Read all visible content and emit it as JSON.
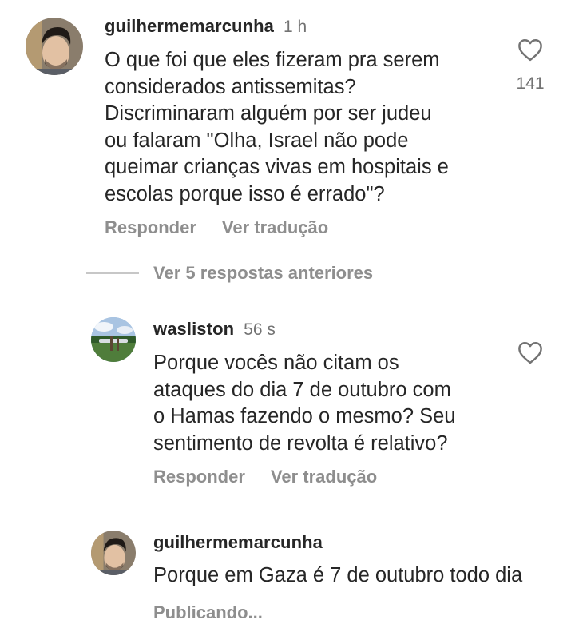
{
  "comments": [
    {
      "username": "guilhermemarcunha",
      "time": "1 h",
      "text": "O que foi que eles fizeram pra serem\nconsiderados antissemitas?\nDiscriminaram alguém por ser judeu\nou falaram \"Olha, Israel não pode\nqueimar crianças vivas em hospitais e\nescolas porque isso é errado\"?",
      "likes": "141",
      "reply_label": "Responder",
      "translate_label": "Ver tradução"
    }
  ],
  "view_replies_label": "Ver 5 respostas anteriores",
  "replies": [
    {
      "username": "wasliston",
      "time": "56 s",
      "text": "Porque vocês não citam os\nataques do dia 7 de outubro com\no Hamas fazendo o mesmo? Seu\nsentimento de revolta é relativo?",
      "reply_label": "Responder",
      "translate_label": "Ver tradução"
    },
    {
      "username": "guilhermemarcunha",
      "text": "Porque em Gaza é 7 de outubro todo dia",
      "status": "Publicando..."
    }
  ],
  "icons": {
    "like": "heart-outline-icon"
  },
  "colors": {
    "text": "#262626",
    "secondary": "#737373",
    "action": "#8e8e8e"
  }
}
